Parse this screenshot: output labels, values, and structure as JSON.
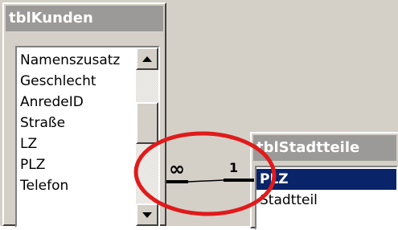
{
  "colors": {
    "workspace": "#d4d0c8",
    "titlebar_inactive": "#9c9a98",
    "selection": "#0a246a",
    "highlight_ring": "#e01b1b"
  },
  "tables": [
    {
      "title": "tblKunden",
      "fields": [
        "Namenszusatz",
        "Geschlecht",
        "AnredeID",
        "Straße",
        "LZ",
        "PLZ",
        "Telefon"
      ]
    },
    {
      "title": "tblStadtteile",
      "fields": [
        "PLZ",
        "Stadtteil"
      ],
      "selected_field": "PLZ"
    }
  ],
  "relationship": {
    "many_side": "∞",
    "one_side": "1"
  }
}
